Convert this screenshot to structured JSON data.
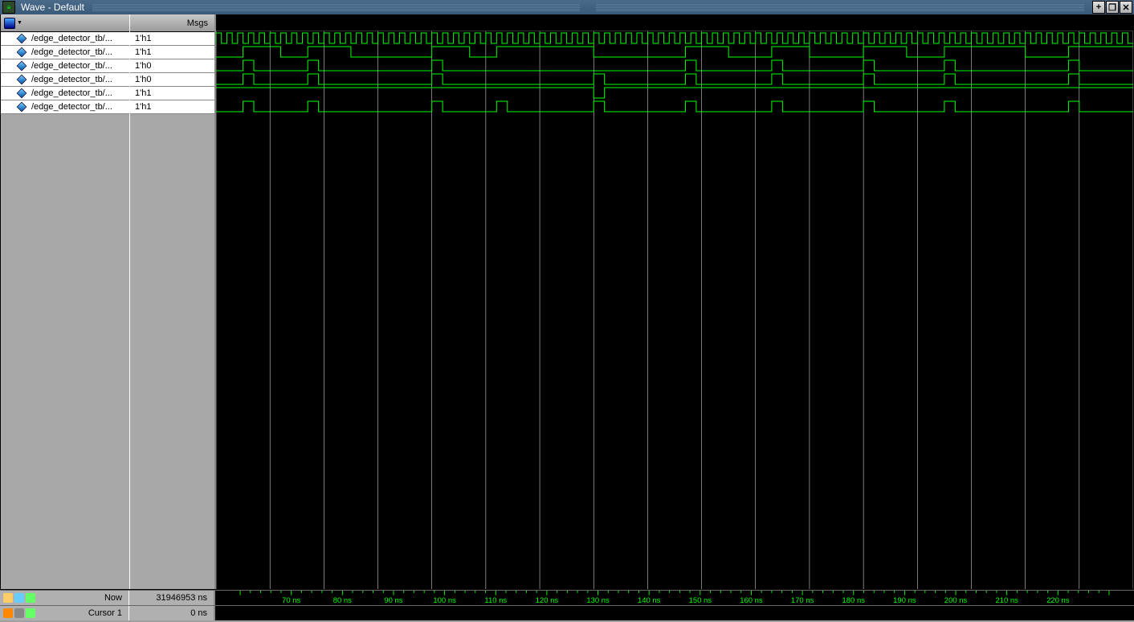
{
  "window": {
    "title": "Wave - Default",
    "controls": {
      "plus": "+",
      "max": "❐",
      "close": "✕"
    }
  },
  "columns": {
    "names_header_icon": "wave",
    "values_header": "Msgs"
  },
  "signals": [
    {
      "name": "/edge_detector_tb/...",
      "value": "1'h1"
    },
    {
      "name": "/edge_detector_tb/...",
      "value": "1'h1"
    },
    {
      "name": "/edge_detector_tb/...",
      "value": "1'h0"
    },
    {
      "name": "/edge_detector_tb/...",
      "value": "1'h0"
    },
    {
      "name": "/edge_detector_tb/...",
      "value": "1'h1"
    },
    {
      "name": "/edge_detector_tb/...",
      "value": "1'h1"
    }
  ],
  "timeline": {
    "unit": "ns",
    "start": 60,
    "end": 230,
    "major_every": 10,
    "labels": [
      70,
      80,
      90,
      100,
      110,
      120,
      130,
      140,
      150,
      160,
      170,
      180,
      190,
      200,
      210,
      220
    ]
  },
  "footer": {
    "now_label": "Now",
    "now_value": "31946953 ns",
    "cursor_label": "Cursor 1",
    "cursor_value": "0 ns"
  },
  "chart_data": {
    "type": "waveform",
    "time_start": 60,
    "time_end": 230,
    "clock": {
      "period": 2,
      "start": 60
    },
    "signal_2": {
      "description": "input data",
      "transitions": [
        [
          60,
          0
        ],
        [
          65,
          1
        ],
        [
          72,
          0
        ],
        [
          77,
          1
        ],
        [
          85,
          0
        ],
        [
          100,
          1
        ],
        [
          107,
          0
        ],
        [
          112,
          1
        ],
        [
          130,
          0
        ],
        [
          147,
          1
        ],
        [
          155,
          0
        ],
        [
          163,
          1
        ],
        [
          170,
          0
        ],
        [
          180,
          1
        ],
        [
          188,
          0
        ],
        [
          195,
          1
        ],
        [
          210,
          0
        ],
        [
          218,
          1
        ]
      ]
    },
    "signal_3": {
      "description": "pulses A",
      "pulses": [
        [
          65,
          2
        ],
        [
          77,
          2
        ],
        [
          100,
          2
        ],
        [
          147,
          2
        ],
        [
          163,
          2
        ],
        [
          180,
          2
        ],
        [
          195,
          2
        ],
        [
          218,
          2
        ]
      ]
    },
    "signal_4": {
      "description": "pulses B",
      "pulses": [
        [
          65,
          2
        ],
        [
          77,
          2
        ],
        [
          100,
          2
        ],
        [
          130,
          2
        ],
        [
          147,
          2
        ],
        [
          163,
          2
        ],
        [
          180,
          2
        ],
        [
          195,
          2
        ],
        [
          218,
          2
        ]
      ]
    },
    "signal_5": {
      "description": "wide",
      "transitions": [
        [
          60,
          1
        ],
        [
          130,
          0
        ],
        [
          132,
          1
        ]
      ]
    },
    "signal_6": {
      "description": "pulses C",
      "pulses": [
        [
          65,
          2
        ],
        [
          77,
          2
        ],
        [
          100,
          2
        ],
        [
          112,
          2
        ],
        [
          130,
          2
        ],
        [
          147,
          2
        ],
        [
          163,
          2
        ],
        [
          180,
          2
        ],
        [
          195,
          2
        ],
        [
          218,
          2
        ]
      ]
    }
  }
}
